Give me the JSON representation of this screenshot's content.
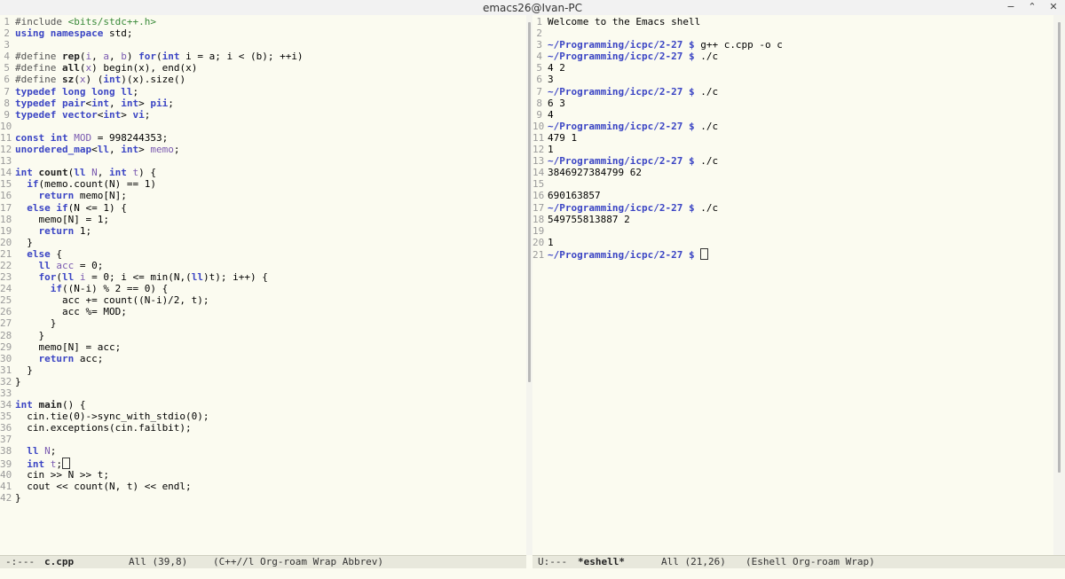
{
  "window": {
    "title": "emacs26@Ivan-PC"
  },
  "left_buffer": {
    "lines": [
      {
        "n": "1",
        "html": "<span class='pp'>#include</span> <span class='str'>&lt;bits/stdc++.h&gt;</span>"
      },
      {
        "n": "2",
        "html": "<span class='kw'>using namespace</span> std;"
      },
      {
        "n": "3",
        "html": ""
      },
      {
        "n": "4",
        "html": "<span class='pp'>#define</span> <span class='fn'>rep</span>(<span class='var'>i</span>, <span class='var'>a</span>, <span class='var'>b</span>) <span class='kw'>for</span>(<span class='ty'>int</span> i = a; i &lt; (b); ++i)"
      },
      {
        "n": "5",
        "html": "<span class='pp'>#define</span> <span class='fn'>all</span>(<span class='var'>x</span>) begin(x), end(x)"
      },
      {
        "n": "6",
        "html": "<span class='pp'>#define</span> <span class='fn'>sz</span>(<span class='var'>x</span>) (<span class='ty'>int</span>)(x).size()"
      },
      {
        "n": "7",
        "html": "<span class='kw'>typedef</span> <span class='ty'>long long</span> <span class='ty'>ll</span>;"
      },
      {
        "n": "8",
        "html": "<span class='kw'>typedef</span> <span class='ty'>pair</span>&lt;<span class='ty'>int</span>, <span class='ty'>int</span>&gt; <span class='ty'>pii</span>;"
      },
      {
        "n": "9",
        "html": "<span class='kw'>typedef</span> <span class='ty'>vector</span>&lt;<span class='ty'>int</span>&gt; <span class='ty'>vi</span>;"
      },
      {
        "n": "10",
        "html": ""
      },
      {
        "n": "11",
        "html": "<span class='kw'>const</span> <span class='ty'>int</span> <span class='var'>MOD</span> = 998244353;"
      },
      {
        "n": "12",
        "html": "<span class='ty'>unordered_map</span>&lt;<span class='ty'>ll</span>, <span class='ty'>int</span>&gt; <span class='var'>memo</span>;"
      },
      {
        "n": "13",
        "html": ""
      },
      {
        "n": "14",
        "html": "<span class='ty'>int</span> <span class='fn'>count</span>(<span class='ty'>ll</span> <span class='var'>N</span>, <span class='ty'>int</span> <span class='var'>t</span>) {"
      },
      {
        "n": "15",
        "html": "  <span class='kw'>if</span>(memo.count(N) == 1)"
      },
      {
        "n": "16",
        "html": "    <span class='kw'>return</span> memo[N];"
      },
      {
        "n": "17",
        "html": "  <span class='kw'>else if</span>(N &lt;= 1) {"
      },
      {
        "n": "18",
        "html": "    memo[N] = 1;"
      },
      {
        "n": "19",
        "html": "    <span class='kw'>return</span> 1;"
      },
      {
        "n": "20",
        "html": "  }"
      },
      {
        "n": "21",
        "html": "  <span class='kw'>else</span> {"
      },
      {
        "n": "22",
        "html": "    <span class='ty'>ll</span> <span class='var'>acc</span> = 0;"
      },
      {
        "n": "23",
        "html": "    <span class='kw'>for</span>(<span class='ty'>ll</span> <span class='var'>i</span> = 0; i &lt;= min(N,(<span class='ty'>ll</span>)t); i++) {"
      },
      {
        "n": "24",
        "html": "      <span class='kw'>if</span>((N-i) % 2 == 0) {"
      },
      {
        "n": "25",
        "html": "        acc += count((N-i)/2, t);"
      },
      {
        "n": "26",
        "html": "        acc %= MOD;"
      },
      {
        "n": "27",
        "html": "      }"
      },
      {
        "n": "28",
        "html": "    }"
      },
      {
        "n": "29",
        "html": "    memo[N] = acc;"
      },
      {
        "n": "30",
        "html": "    <span class='kw'>return</span> acc;"
      },
      {
        "n": "31",
        "html": "  }"
      },
      {
        "n": "32",
        "html": "}"
      },
      {
        "n": "33",
        "html": ""
      },
      {
        "n": "34",
        "html": "<span class='ty'>int</span> <span class='fn'>main</span>() {"
      },
      {
        "n": "35",
        "html": "  cin.tie(0)-&gt;sync_with_stdio(0);"
      },
      {
        "n": "36",
        "html": "  cin.exceptions(cin.failbit);"
      },
      {
        "n": "37",
        "html": ""
      },
      {
        "n": "38",
        "html": "  <span class='ty'>ll</span> <span class='var'>N</span>;"
      },
      {
        "n": "39",
        "html": "  <span class='ty'>int</span> <span class='var'>t</span>;<span class='cursor'></span>"
      },
      {
        "n": "40",
        "html": "  cin &gt;&gt; N &gt;&gt; t;"
      },
      {
        "n": "41",
        "html": "  cout &lt;&lt; count(N, t) &lt;&lt; endl;"
      },
      {
        "n": "42",
        "html": "}"
      }
    ]
  },
  "right_buffer": {
    "lines": [
      {
        "n": "1",
        "html": "Welcome to the Emacs shell"
      },
      {
        "n": "2",
        "html": ""
      },
      {
        "n": "3",
        "html": "<span class='prompt'>~/Programming/icpc/2-27 $</span> g++ c.cpp -o c"
      },
      {
        "n": "4",
        "html": "<span class='prompt'>~/Programming/icpc/2-27 $</span> ./c"
      },
      {
        "n": "5",
        "html": "4 2"
      },
      {
        "n": "6",
        "html": "3"
      },
      {
        "n": "7",
        "html": "<span class='prompt'>~/Programming/icpc/2-27 $</span> ./c"
      },
      {
        "n": "8",
        "html": "6 3"
      },
      {
        "n": "9",
        "html": "4"
      },
      {
        "n": "10",
        "html": "<span class='prompt'>~/Programming/icpc/2-27 $</span> ./c"
      },
      {
        "n": "11",
        "html": "479 1"
      },
      {
        "n": "12",
        "html": "1"
      },
      {
        "n": "13",
        "html": "<span class='prompt'>~/Programming/icpc/2-27 $</span> ./c"
      },
      {
        "n": "14",
        "html": "3846927384799 62"
      },
      {
        "n": "15",
        "html": ""
      },
      {
        "n": "16",
        "html": "690163857"
      },
      {
        "n": "17",
        "html": "<span class='prompt'>~/Programming/icpc/2-27 $</span> ./c"
      },
      {
        "n": "18",
        "html": "549755813887 2"
      },
      {
        "n": "19",
        "html": ""
      },
      {
        "n": "20",
        "html": "1"
      },
      {
        "n": "21",
        "html": "<span class='prompt'>~/Programming/icpc/2-27 $</span> <span class='cursor'></span>"
      }
    ]
  },
  "left_modeline": {
    "status": "-:---",
    "buffer": "c.cpp",
    "position": "All (39,8)",
    "modes": "(C++//l Org-roam Wrap Abbrev)"
  },
  "right_modeline": {
    "status": "U:---",
    "buffer": "*eshell*",
    "position": "All (21,26)",
    "modes": "(Eshell Org-roam Wrap)"
  },
  "colors": {
    "background": "#fbfbf0",
    "keyword": "#3b45c4",
    "string": "#3a8a3a",
    "variable": "#7a5ab0"
  }
}
